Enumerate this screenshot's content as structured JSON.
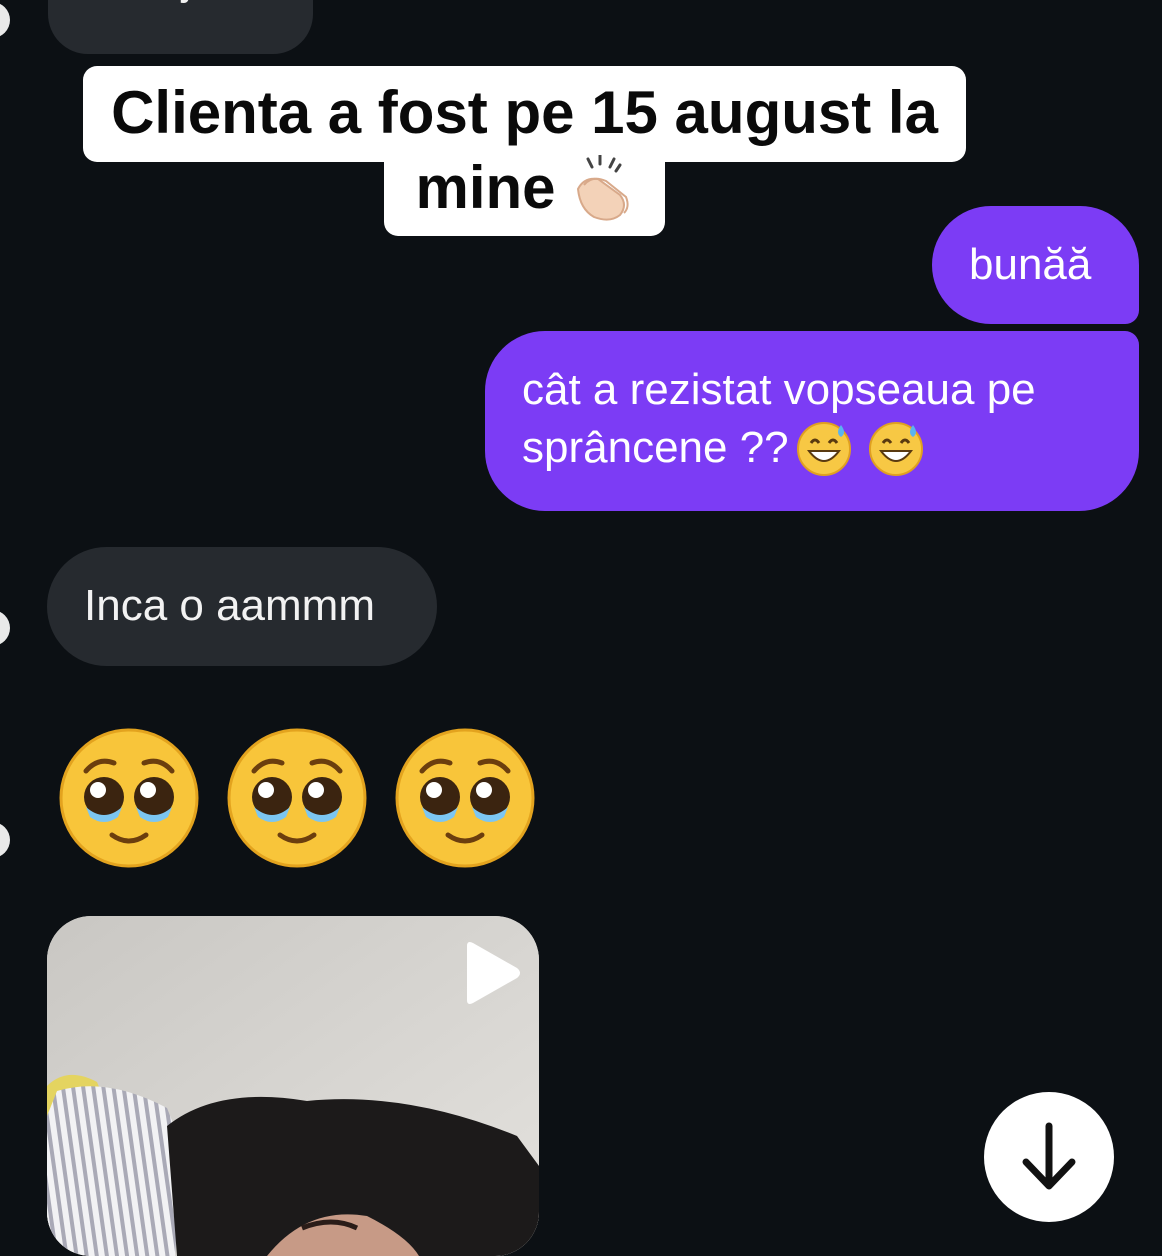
{
  "messages": {
    "top_partial": "am ajuns",
    "out_1": "bunăă",
    "out_2_line1": "cât a rezistat vopseaua pe",
    "out_2_line2": "sprâncene ??",
    "in_1": "Inca o aammm"
  },
  "caption": {
    "line1": "Clienta a fost pe 15 august la",
    "line2": "mine"
  },
  "icons": {
    "clap": "clapping-hands-emoji",
    "sweat_smile": "grinning-face-with-sweat-emoji",
    "pleading": "pleading-face-emoji",
    "play": "play-icon",
    "scroll_down": "arrow-down-icon"
  },
  "colors": {
    "background": "#0c1014",
    "incoming_bubble": "#262a2f",
    "outgoing_bubble": "#7c3cf5",
    "caption_bg": "#ffffff"
  }
}
